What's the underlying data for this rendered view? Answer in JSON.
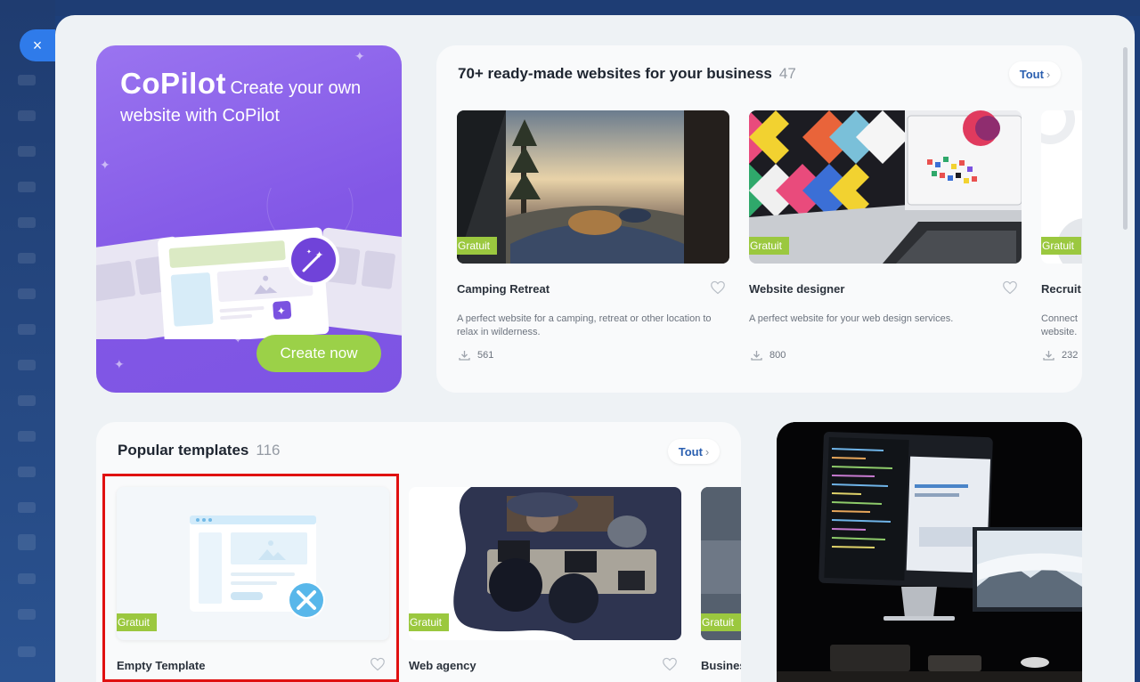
{
  "close_icon": "×",
  "copilot": {
    "brand": "CoPilot",
    "subtitle_1": "Create your own",
    "subtitle_2": "website with CoPilot",
    "cta": "Create now"
  },
  "ready_made": {
    "title": "70+ ready-made websites for your business",
    "count": "47",
    "all_label": "Tout",
    "items": [
      {
        "name": "Camping Retreat",
        "badge": "Gratuit",
        "desc": "A perfect website for a camping, retreat or other location to relax in wilderness.",
        "downloads": "561"
      },
      {
        "name": "Website designer",
        "badge": "Gratuit",
        "desc": "A perfect website for your web design services.",
        "downloads": "800"
      },
      {
        "name": "Recruit",
        "badge": "Gratuit",
        "desc": "Connect website.",
        "downloads": "232"
      }
    ]
  },
  "popular": {
    "title": "Popular templates",
    "count": "116",
    "all_label": "Tout",
    "items": [
      {
        "name": "Empty Template",
        "badge": "Gratuit"
      },
      {
        "name": "Web agency",
        "badge": "Gratuit"
      },
      {
        "name": "Busines",
        "badge": "Gratuit"
      }
    ]
  },
  "colors": {
    "accent": "#2f7bea",
    "copilot_purple": "#8257e6",
    "badge_green": "#9bc83f",
    "highlight": "#e01010"
  }
}
